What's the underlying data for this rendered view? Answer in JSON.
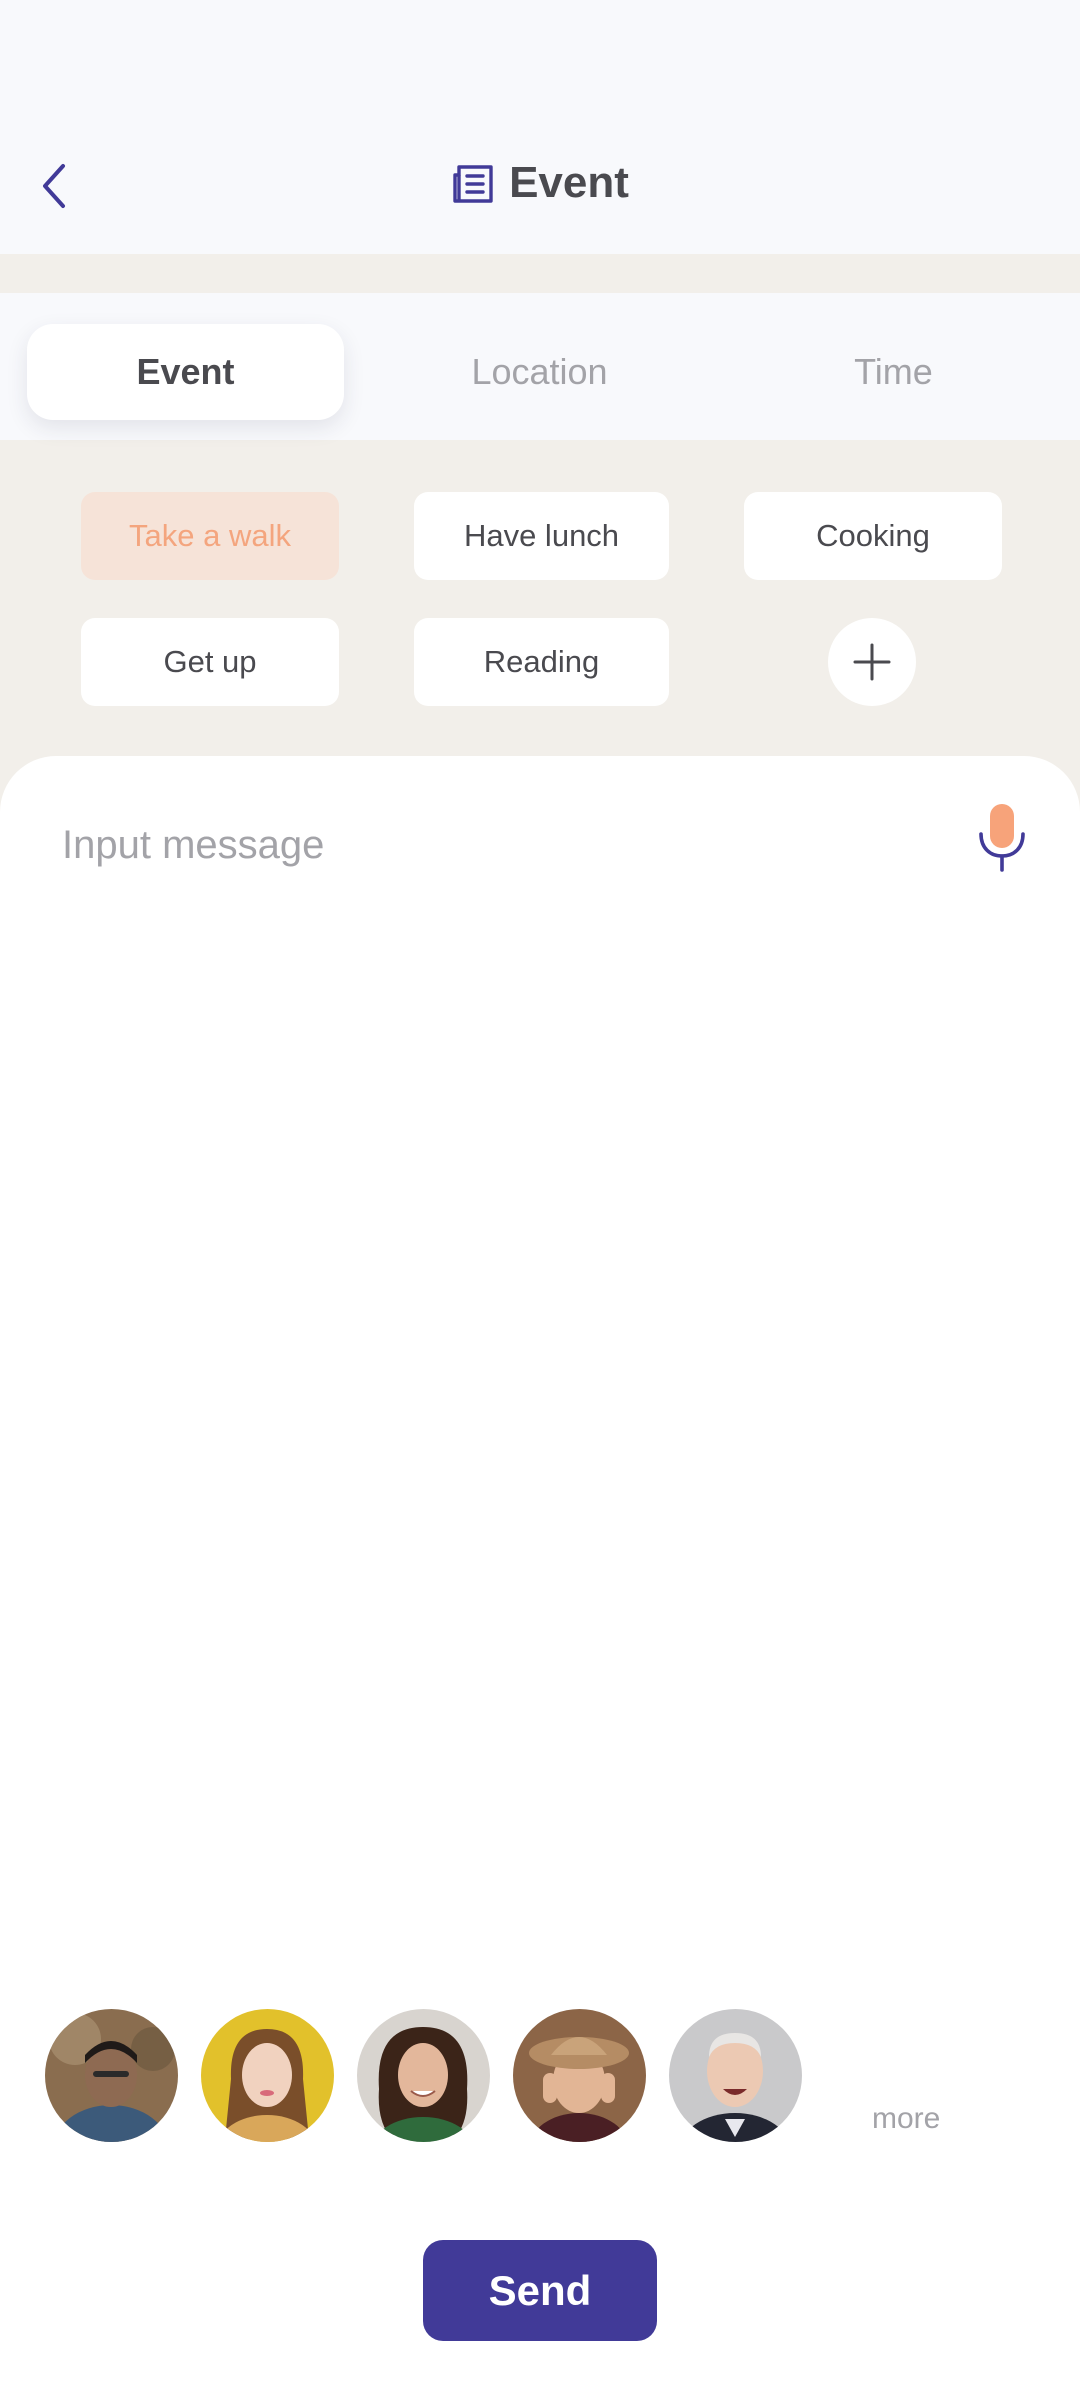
{
  "header": {
    "title": "Event",
    "title_icon": "document-list-icon",
    "back_icon": "chevron-left-icon"
  },
  "tabs": [
    {
      "label": "Event",
      "active": true
    },
    {
      "label": "Location",
      "active": false
    },
    {
      "label": "Time",
      "active": false
    }
  ],
  "chips": [
    {
      "label": "Take a walk",
      "selected": true
    },
    {
      "label": "Have lunch",
      "selected": false
    },
    {
      "label": "Cooking",
      "selected": false
    },
    {
      "label": "Get up",
      "selected": false
    },
    {
      "label": "Reading",
      "selected": false
    }
  ],
  "add_chip_icon": "plus-icon",
  "message": {
    "placeholder": "Input message",
    "value": "",
    "mic_icon": "microphone-icon"
  },
  "avatars": [
    {
      "name": "avatar-1",
      "bg": "#8a6d4f",
      "skin": "#8e6a52",
      "hair": "#1f1a18",
      "shirt": "#3c5a7a"
    },
    {
      "name": "avatar-2",
      "bg": "#e2c12b",
      "skin": "#f1d2bf",
      "hair": "#7a4e2a",
      "shirt": "#d9a75a"
    },
    {
      "name": "avatar-3",
      "bg": "#d8d4cf",
      "skin": "#e3b79b",
      "hair": "#3b2418",
      "shirt": "#2f6b3c"
    },
    {
      "name": "avatar-4",
      "bg": "#8c6547",
      "skin": "#e2b595",
      "hair": "#b58c64",
      "shirt": "#4a1f24"
    },
    {
      "name": "avatar-5",
      "bg": "#c9c9cb",
      "skin": "#ecc9b3",
      "hair": "#e8e6e4",
      "shirt": "#232633"
    }
  ],
  "more_label": "more",
  "send_label": "Send",
  "colors": {
    "accent": "#413a98",
    "selected_chip_bg": "#f6e3d8",
    "selected_chip_text": "#f4a57e",
    "mic_orange": "#f7a37a",
    "page_bg": "#f2efea"
  }
}
